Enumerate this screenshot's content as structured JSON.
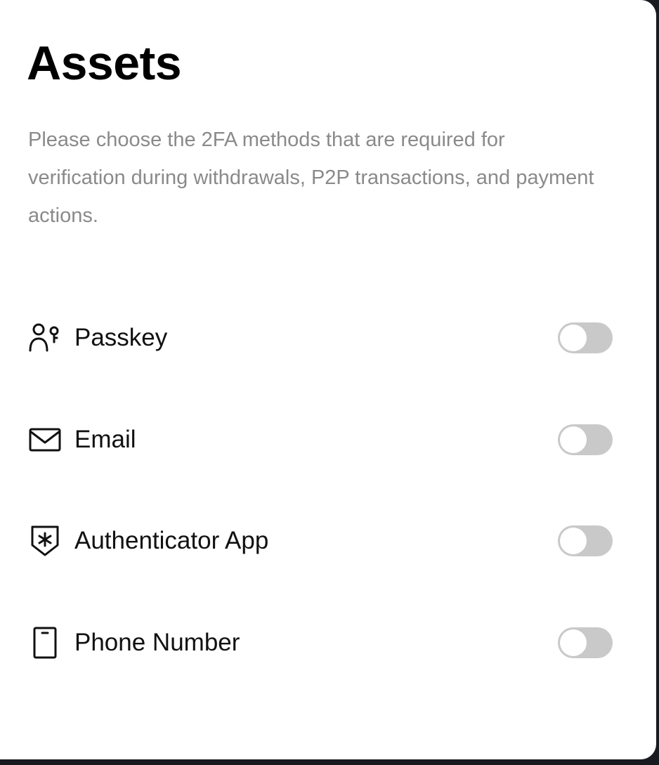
{
  "panel": {
    "title": "Assets",
    "description": "Please choose the 2FA methods that are required for verification during withdrawals, P2P transactions, and payment actions."
  },
  "methods": [
    {
      "label": "Passkey",
      "icon": "passkey-icon",
      "enabled": false
    },
    {
      "label": "Email",
      "icon": "mail-icon",
      "enabled": false
    },
    {
      "label": "Authenticator App",
      "icon": "authenticator-shield-icon",
      "enabled": false
    },
    {
      "label": "Phone Number",
      "icon": "phone-icon",
      "enabled": false
    }
  ],
  "colors": {
    "toggle_off": "#c9c9c9",
    "background": "#181a20",
    "panel": "#ffffff",
    "text_primary": "#111111",
    "text_secondary": "#8a8a8a"
  }
}
